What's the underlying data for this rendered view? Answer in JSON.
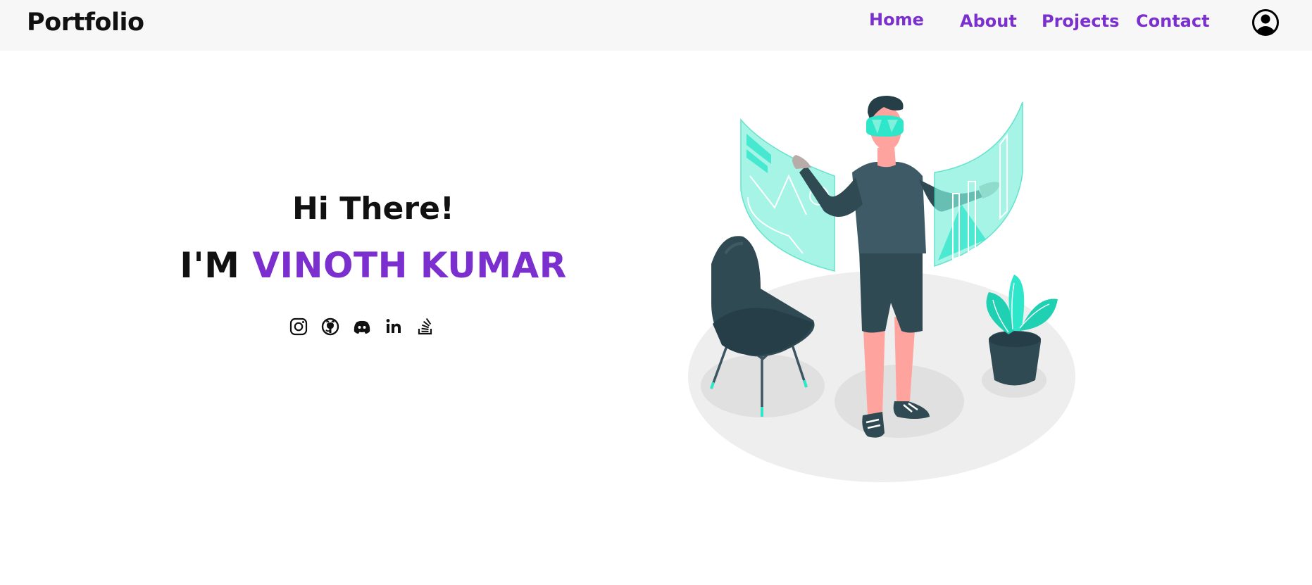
{
  "navbar": {
    "brand": "Portfolio",
    "links": [
      "Home",
      "About",
      "Projects",
      "Contact"
    ],
    "user_icon": "user-circle-icon"
  },
  "hero": {
    "greeting": "Hi There!",
    "name_prefix": "I'M ",
    "name": "VINOTH KUMAR"
  },
  "socials": [
    {
      "name": "instagram-icon"
    },
    {
      "name": "github-icon"
    },
    {
      "name": "discord-icon"
    },
    {
      "name": "linkedin-icon"
    },
    {
      "name": "stackoverflow-icon"
    }
  ],
  "colors": {
    "accent": "#7b2fce",
    "navbar_bg": "#f7f7f7",
    "text": "#111111",
    "teal": "#2ee6c9",
    "dark_slate": "#2f4a53"
  },
  "illustration": "vr-person-illustration"
}
